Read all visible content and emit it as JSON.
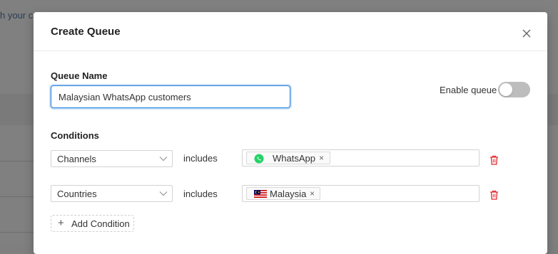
{
  "background": {
    "text": "h your c"
  },
  "modal": {
    "title": "Create Queue",
    "close_icon": "close-icon"
  },
  "queue_name": {
    "label": "Queue Name",
    "value": "Malaysian WhatsApp customers"
  },
  "enable_queue": {
    "label": "Enable queue",
    "enabled": false
  },
  "conditions": {
    "label": "Conditions",
    "rows": [
      {
        "field": "Channels",
        "operator": "includes",
        "tags": [
          {
            "icon": "whatsapp-icon",
            "label": "WhatsApp"
          }
        ]
      },
      {
        "field": "Countries",
        "operator": "includes",
        "tags": [
          {
            "icon": "malaysia-flag-icon",
            "label": "Malaysia"
          }
        ]
      }
    ],
    "add_label": "Add Condition"
  },
  "colors": {
    "primary": "#1f7fdc",
    "danger": "#e0282e",
    "whatsapp": "#25d366"
  }
}
